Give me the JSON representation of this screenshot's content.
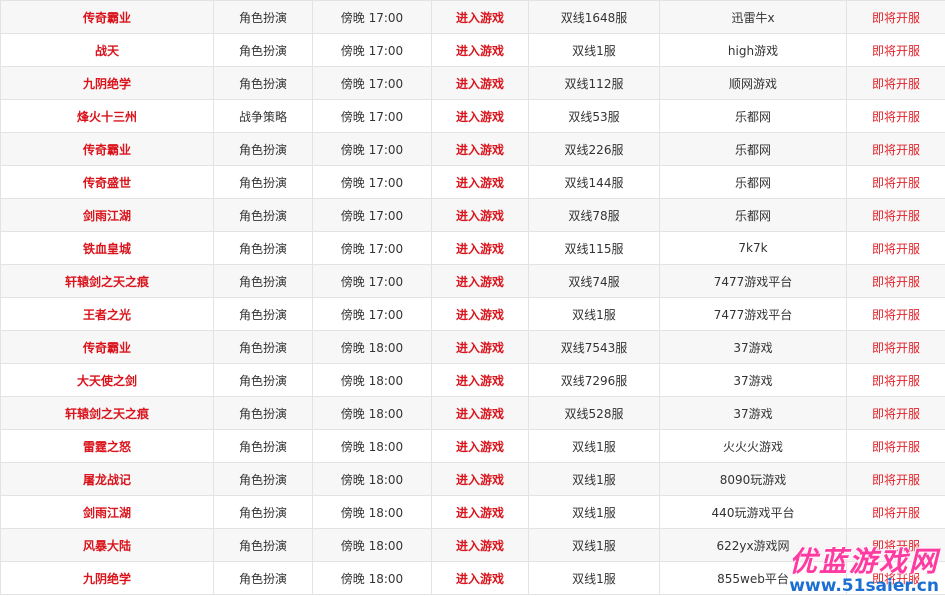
{
  "rows": [
    {
      "name": "传奇霸业",
      "type": "角色扮演",
      "time": "傍晚 17:00",
      "enter": "进入游戏",
      "server": "双线1648服",
      "platform": "迅雷牛x",
      "status": "即将开服"
    },
    {
      "name": "战天",
      "type": "角色扮演",
      "time": "傍晚 17:00",
      "enter": "进入游戏",
      "server": "双线1服",
      "platform": "high游戏",
      "status": "即将开服"
    },
    {
      "name": "九阴绝学",
      "type": "角色扮演",
      "time": "傍晚 17:00",
      "enter": "进入游戏",
      "server": "双线112服",
      "platform": "顺网游戏",
      "status": "即将开服"
    },
    {
      "name": "烽火十三州",
      "type": "战争策略",
      "time": "傍晚 17:00",
      "enter": "进入游戏",
      "server": "双线53服",
      "platform": "乐都网",
      "status": "即将开服"
    },
    {
      "name": "传奇霸业",
      "type": "角色扮演",
      "time": "傍晚 17:00",
      "enter": "进入游戏",
      "server": "双线226服",
      "platform": "乐都网",
      "status": "即将开服"
    },
    {
      "name": "传奇盛世",
      "type": "角色扮演",
      "time": "傍晚 17:00",
      "enter": "进入游戏",
      "server": "双线144服",
      "platform": "乐都网",
      "status": "即将开服"
    },
    {
      "name": "剑雨江湖",
      "type": "角色扮演",
      "time": "傍晚 17:00",
      "enter": "进入游戏",
      "server": "双线78服",
      "platform": "乐都网",
      "status": "即将开服"
    },
    {
      "name": "铁血皇城",
      "type": "角色扮演",
      "time": "傍晚 17:00",
      "enter": "进入游戏",
      "server": "双线115服",
      "platform": "7k7k",
      "status": "即将开服"
    },
    {
      "name": "轩辕剑之天之痕",
      "type": "角色扮演",
      "time": "傍晚 17:00",
      "enter": "进入游戏",
      "server": "双线74服",
      "platform": "7477游戏平台",
      "status": "即将开服"
    },
    {
      "name": "王者之光",
      "type": "角色扮演",
      "time": "傍晚 17:00",
      "enter": "进入游戏",
      "server": "双线1服",
      "platform": "7477游戏平台",
      "status": "即将开服"
    },
    {
      "name": "传奇霸业",
      "type": "角色扮演",
      "time": "傍晚 18:00",
      "enter": "进入游戏",
      "server": "双线7543服",
      "platform": "37游戏",
      "status": "即将开服"
    },
    {
      "name": "大天使之剑",
      "type": "角色扮演",
      "time": "傍晚 18:00",
      "enter": "进入游戏",
      "server": "双线7296服",
      "platform": "37游戏",
      "status": "即将开服"
    },
    {
      "name": "轩辕剑之天之痕",
      "type": "角色扮演",
      "time": "傍晚 18:00",
      "enter": "进入游戏",
      "server": "双线528服",
      "platform": "37游戏",
      "status": "即将开服"
    },
    {
      "name": "雷霆之怒",
      "type": "角色扮演",
      "time": "傍晚 18:00",
      "enter": "进入游戏",
      "server": "双线1服",
      "platform": "火火火游戏",
      "status": "即将开服"
    },
    {
      "name": "屠龙战记",
      "type": "角色扮演",
      "time": "傍晚 18:00",
      "enter": "进入游戏",
      "server": "双线1服",
      "platform": "8090玩游戏",
      "status": "即将开服"
    },
    {
      "name": "剑雨江湖",
      "type": "角色扮演",
      "time": "傍晚 18:00",
      "enter": "进入游戏",
      "server": "双线1服",
      "platform": "440玩游戏平台",
      "status": "即将开服"
    },
    {
      "name": "风暴大陆",
      "type": "角色扮演",
      "time": "傍晚 18:00",
      "enter": "进入游戏",
      "server": "双线1服",
      "platform": "622yx游戏网",
      "status": "即将开服"
    },
    {
      "name": "九阴绝学",
      "type": "角色扮演",
      "time": "傍晚 18:00",
      "enter": "进入游戏",
      "server": "双线1服",
      "platform": "855web平台",
      "status": "即将开服"
    }
  ],
  "watermark": {
    "logo_text": "优蓝游戏网",
    "url_text": "www.51saier.cn"
  },
  "colors": {
    "game_name": "#d9141c",
    "enter_link": "#d9141c",
    "status": "#e0222a",
    "row_alt": "#f7f7f7",
    "border": "#e3e3e3"
  },
  "icons": {
    "left_marker": "selection-marker"
  }
}
